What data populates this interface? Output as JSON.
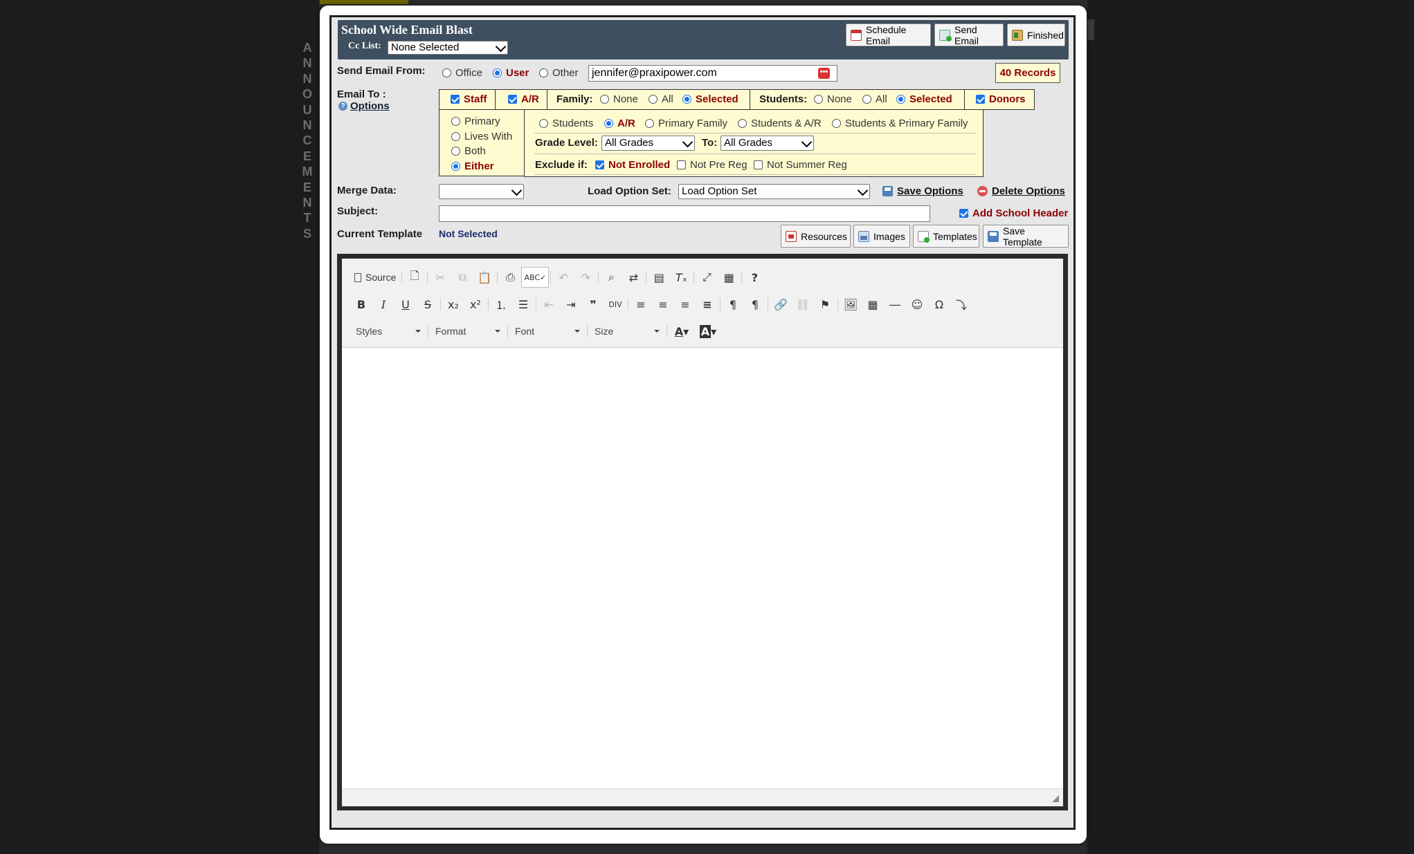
{
  "side_tab": {
    "letters": [
      "A",
      "N",
      "N",
      "O",
      "U",
      "N",
      "C",
      "E",
      "M",
      "E",
      "N",
      "T",
      "S"
    ]
  },
  "header": {
    "title": "School Wide Email Blast",
    "cc_label": "Cc List:",
    "cc_value": "None Selected",
    "buttons": {
      "schedule": "Schedule Email",
      "send": "Send Email",
      "finished": "Finished"
    }
  },
  "send_from": {
    "label": "Send Email From:",
    "options": [
      "Office",
      "User",
      "Other"
    ],
    "selected": "User",
    "email_value": "jennifer@praxipower.com",
    "records": "40 Records"
  },
  "email_to": {
    "label": "Email To :",
    "options_link": "Options",
    "staff": "Staff",
    "ar": "A/R",
    "family_label": "Family:",
    "family_options": [
      "None",
      "All",
      "Selected"
    ],
    "students_label": "Students:",
    "students_options": [
      "None",
      "All",
      "Selected"
    ],
    "donors": "Donors",
    "contact_options": [
      "Primary",
      "Lives With",
      "Both",
      "Either"
    ],
    "contact_selected": "Either",
    "recipient_options": [
      "Students",
      "A/R",
      "Primary Family",
      "Students & A/R",
      "Students & Primary Family"
    ],
    "recipient_selected": "A/R",
    "grade_label": "Grade Level:",
    "grade_from": "All Grades",
    "to_label": "To:",
    "grade_to": "All Grades",
    "exclude_label": "Exclude if:",
    "exclude_options": [
      "Not Enrolled",
      "Not Pre Reg",
      "Not Summer Reg"
    ]
  },
  "merge": {
    "label": "Merge Data:",
    "value": "",
    "load_label": "Load Option Set:",
    "load_value": "Load Option Set",
    "save_options": "Save Options",
    "delete_options": "Delete Options"
  },
  "subject": {
    "label": "Subject:",
    "value": "",
    "add_header": "Add School Header"
  },
  "template": {
    "label": "Current Template",
    "value": "Not Selected",
    "buttons": {
      "resources": "Resources",
      "images": "Images",
      "templates": "Templates",
      "save": "Save Template"
    }
  },
  "editor": {
    "source": "Source",
    "combos": {
      "styles": "Styles",
      "format": "Format",
      "font": "Font",
      "size": "Size"
    }
  },
  "colors": {
    "accent": "#8b0000",
    "titlebar": "#3e4f5f",
    "highlight": "#fffbd0"
  }
}
